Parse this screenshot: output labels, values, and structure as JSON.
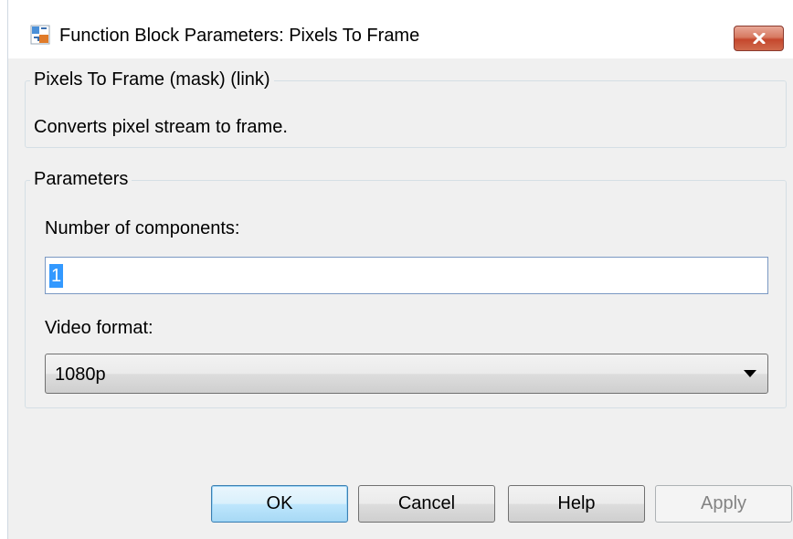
{
  "window": {
    "title": "Function Block Parameters: Pixels To Frame",
    "icon": "simulink-block-icon",
    "close_icon": "close-icon"
  },
  "description_group": {
    "legend": "Pixels To Frame (mask) (link)",
    "text": "Converts pixel stream to frame."
  },
  "parameters_group": {
    "legend": "Parameters",
    "num_components": {
      "label": "Number of components:",
      "value": "1"
    },
    "video_format": {
      "label": "Video format:",
      "selected": "1080p",
      "arrow_icon": "dropdown-arrow-icon"
    }
  },
  "buttons": {
    "ok": "OK",
    "cancel": "Cancel",
    "help": "Help",
    "apply": "Apply"
  },
  "colors": {
    "close_button": "#c5472d",
    "selection_highlight": "#3399ff",
    "default_button_border": "#3c7fb1",
    "disabled_text": "#838383"
  }
}
